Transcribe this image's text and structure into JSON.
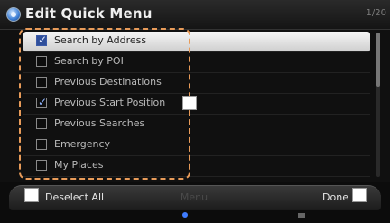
{
  "header": {
    "title": "Edit Quick Menu",
    "page_indicator": "1/20",
    "icon": "settings-globe-icon"
  },
  "menu_items": [
    {
      "label": "Search by Address",
      "checked": true,
      "selected": true
    },
    {
      "label": "Search by POI",
      "checked": false,
      "selected": false
    },
    {
      "label": "Previous Destinations",
      "checked": false,
      "selected": false
    },
    {
      "label": "Previous Start Position",
      "checked": true,
      "selected": false
    },
    {
      "label": "Previous Searches",
      "checked": false,
      "selected": false
    },
    {
      "label": "Emergency",
      "checked": false,
      "selected": false
    },
    {
      "label": "My Places",
      "checked": false,
      "selected": false
    }
  ],
  "buttons": {
    "deselect_all": "Deselect All",
    "menu": "Menu",
    "done": "Done"
  },
  "colors": {
    "highlight_dashed": "#e89b59",
    "checked_box": "#2f4f9b",
    "indicator_blue": "#3f7cff"
  }
}
